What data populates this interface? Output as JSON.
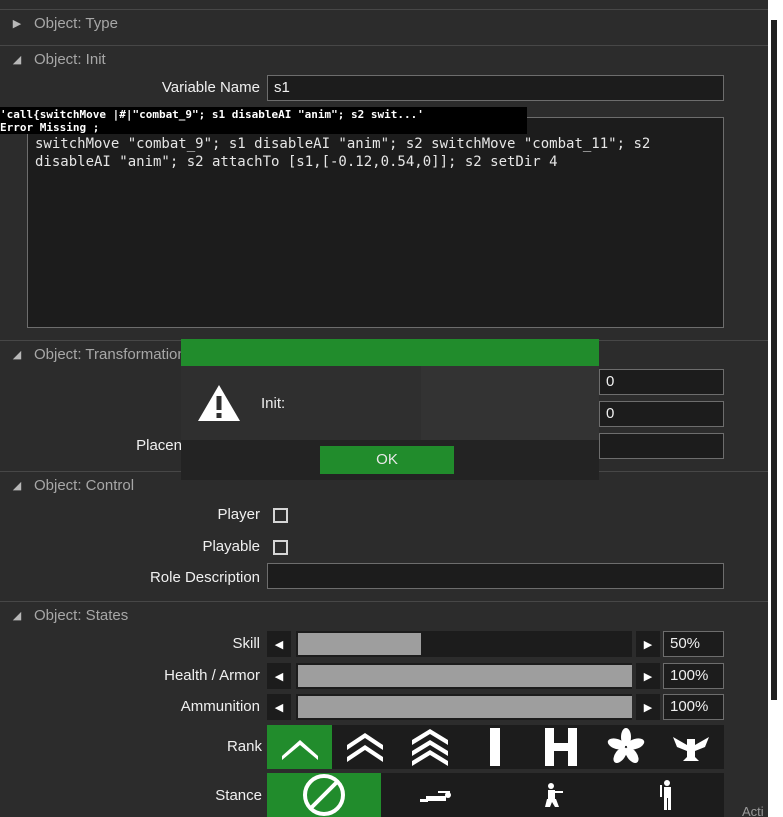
{
  "sections": {
    "type": "Object: Type",
    "init": "Object: Init",
    "transformation": "Object: Transformation",
    "control": "Object: Control",
    "states": "Object: States"
  },
  "init": {
    "variable_name_label": "Variable Name",
    "variable_name_value": "s1",
    "init_code": "switchMove \"combat_9\"; s1 disableAI \"anim\"; s2 switchMove \"combat_11\"; s2 disableAI \"anim\"; s2 attachTo [s1,[-0.12,0.54,0]]; s2 setDir 4",
    "error_line1": "'call{switchMove |#|\"combat_9\"; s1 disableAI \"anim\"; s2 swit...'",
    "error_line2": "Error Missing ;"
  },
  "transformation": {
    "field1_value": "0",
    "field2_value": "0",
    "placement_label_partial": "Placen",
    "field3_value": ""
  },
  "control": {
    "player_label": "Player",
    "player_checked": false,
    "playable_label": "Playable",
    "playable_checked": false,
    "role_label": "Role Description",
    "role_value": ""
  },
  "states": {
    "skill_label": "Skill",
    "skill_value": "50%",
    "skill_fraction": 0.373,
    "health_label": "Health / Armor",
    "health_value": "100%",
    "health_fraction": 1.0,
    "ammo_label": "Ammunition",
    "ammo_value": "100%",
    "ammo_fraction": 1.0,
    "rank_label": "Rank",
    "rank_icons": [
      "private-chevron-icon",
      "corporal-chevrons-icon",
      "sergeant-chevrons-icon",
      "lieutenant-bar-icon",
      "captain-bars-icon",
      "major-leaf-icon",
      "colonel-eagle-icon"
    ],
    "rank_selected": 0,
    "stance_label": "Stance",
    "stance_icons": [
      "auto-stance-icon",
      "prone-stance-icon",
      "crouch-stance-icon",
      "stand-stance-icon"
    ],
    "stance_selected": 0
  },
  "modal": {
    "message": "Init:",
    "ok_label": "OK"
  },
  "corner_text": "Acti"
}
